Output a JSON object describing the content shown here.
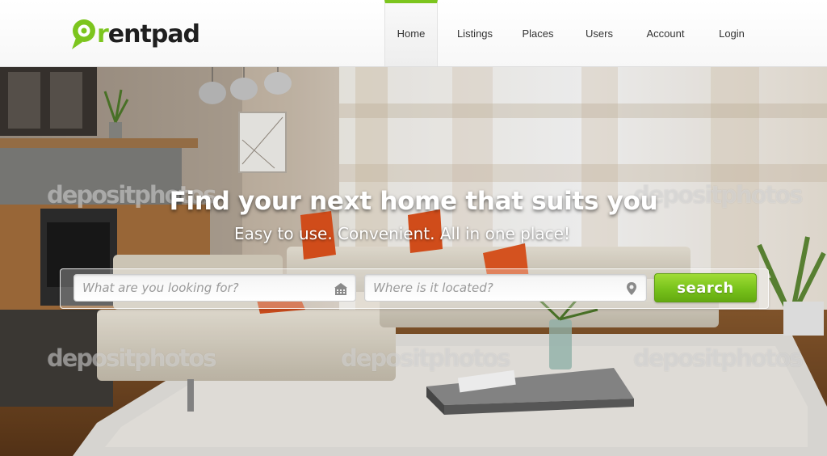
{
  "brand": {
    "logo_text": "rentpad",
    "logo_letter_r": "r",
    "logo_rest": "entpad",
    "accent_color": "#7cc51e"
  },
  "nav": {
    "items": [
      {
        "label": "Home",
        "active": true
      },
      {
        "label": "Listings"
      },
      {
        "label": "Places"
      },
      {
        "label": "Users"
      },
      {
        "label": "Account"
      },
      {
        "label": "Login"
      }
    ]
  },
  "hero": {
    "headline": "Find your next home that suits you",
    "tagline": "Easy to use. Convenient. All in one place!",
    "watermark": "depositphotos",
    "background": "living room interior photo"
  },
  "search": {
    "what_placeholder": "What are you looking for?",
    "where_placeholder": "Where is it located?",
    "what_icon": "building-icon",
    "where_icon": "location-pin-icon",
    "button_label": "search",
    "button_color": "#78c21b"
  }
}
